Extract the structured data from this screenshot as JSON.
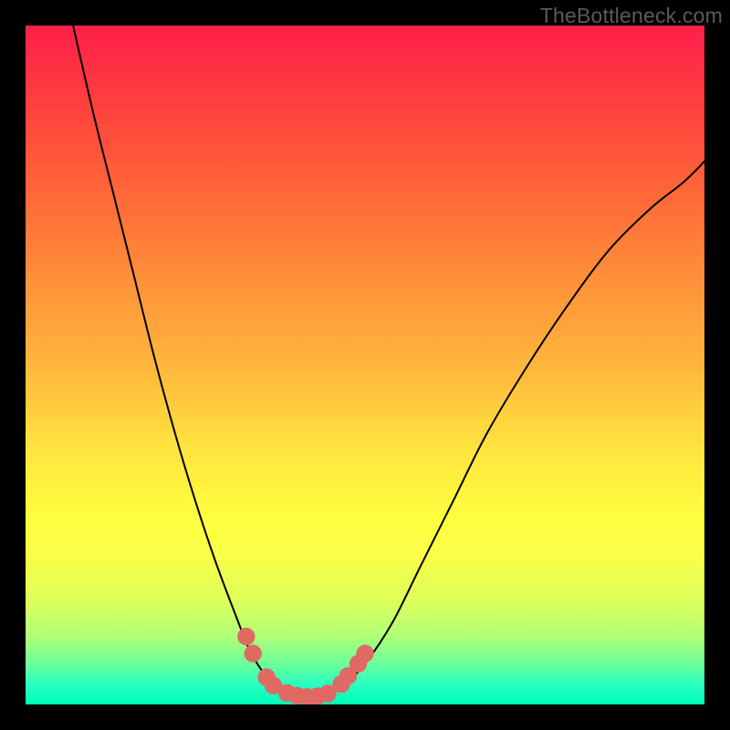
{
  "watermark": "TheBottleneck.com",
  "chart_data": {
    "type": "line",
    "title": "",
    "xlabel": "",
    "ylabel": "",
    "xlim": [
      0,
      100
    ],
    "ylim": [
      0,
      100
    ],
    "grid": false,
    "legend": false,
    "background_gradient": {
      "direction": "vertical",
      "stops": [
        {
          "pos": 0.0,
          "color": "#ff1f4b"
        },
        {
          "pos": 0.5,
          "color": "#ffb63c"
        },
        {
          "pos": 0.73,
          "color": "#ffff3f"
        },
        {
          "pos": 1.0,
          "color": "#00ffb8"
        }
      ]
    },
    "series": [
      {
        "name": "left-branch",
        "stroke": "#000000",
        "x": [
          7,
          10,
          13,
          16,
          19,
          22,
          25,
          28,
          31,
          33,
          34.8,
          36.5,
          38
        ],
        "y": [
          100,
          87,
          75,
          63,
          51,
          40,
          30,
          21,
          13,
          8,
          5,
          3,
          2
        ]
      },
      {
        "name": "right-branch",
        "stroke": "#000000",
        "x": [
          45,
          47,
          50,
          54,
          58,
          63,
          68,
          74,
          80,
          86,
          92,
          97,
          100
        ],
        "y": [
          2,
          3,
          6,
          12,
          20,
          30,
          40,
          50,
          59,
          67,
          73,
          77,
          80
        ]
      },
      {
        "name": "valley",
        "stroke": "#000000",
        "x": [
          38,
          39.5,
          41,
          42.5,
          44,
          45
        ],
        "y": [
          2,
          1.3,
          1.1,
          1.1,
          1.3,
          2
        ]
      }
    ],
    "markers": [
      {
        "series": "left-branch",
        "x": 32.5,
        "y": 10,
        "color": "#e06963",
        "r": 1.3
      },
      {
        "series": "left-branch",
        "x": 33.5,
        "y": 7.5,
        "color": "#e06963",
        "r": 1.3
      },
      {
        "series": "left-branch",
        "x": 35.5,
        "y": 4,
        "color": "#e06963",
        "r": 1.3
      },
      {
        "series": "left-branch",
        "x": 36.5,
        "y": 2.8,
        "color": "#e06963",
        "r": 1.3
      },
      {
        "series": "valley",
        "x": 38.5,
        "y": 1.7,
        "color": "#e06963",
        "r": 1.3
      },
      {
        "series": "valley",
        "x": 40,
        "y": 1.3,
        "color": "#e06963",
        "r": 1.3
      },
      {
        "series": "valley",
        "x": 41.5,
        "y": 1.1,
        "color": "#e06963",
        "r": 1.3
      },
      {
        "series": "valley",
        "x": 43,
        "y": 1.2,
        "color": "#e06963",
        "r": 1.3
      },
      {
        "series": "valley",
        "x": 44.5,
        "y": 1.6,
        "color": "#e06963",
        "r": 1.3
      },
      {
        "series": "right-branch",
        "x": 46.5,
        "y": 3,
        "color": "#e06963",
        "r": 1.3
      },
      {
        "series": "right-branch",
        "x": 47.5,
        "y": 4.2,
        "color": "#e06963",
        "r": 1.3
      },
      {
        "series": "right-branch",
        "x": 49,
        "y": 6,
        "color": "#e06963",
        "r": 1.3
      },
      {
        "series": "right-branch",
        "x": 50,
        "y": 7.5,
        "color": "#e06963",
        "r": 1.3
      }
    ]
  }
}
